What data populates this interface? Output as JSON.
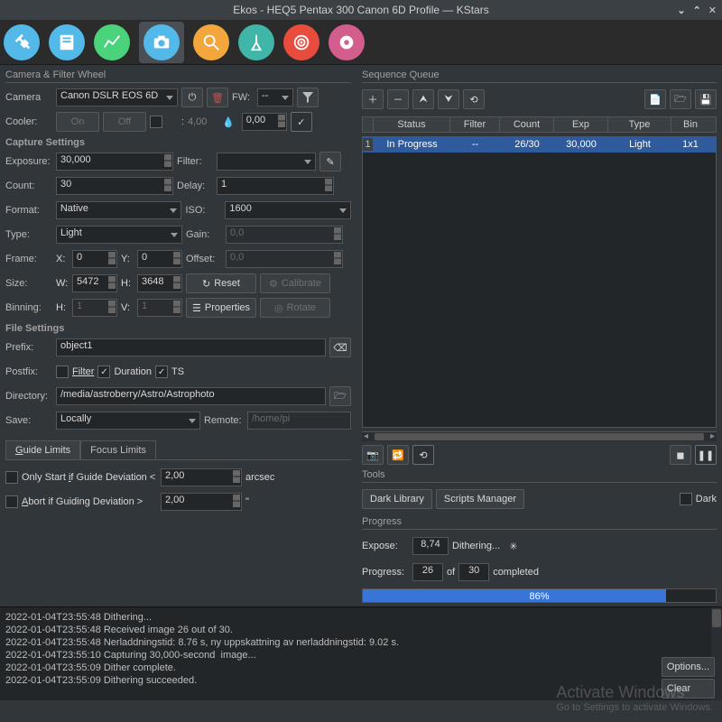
{
  "window": {
    "title": "Ekos - HEQ5 Pentax 300 Canon 6D Profile — KStars"
  },
  "left": {
    "section": "Camera & Filter Wheel",
    "camera_label": "Camera",
    "camera_value": "Canon DSLR EOS 6D",
    "fw_label": "FW:",
    "fw_value": "--",
    "cooler_label": "Cooler:",
    "cooler_on": "On",
    "cooler_off": "Off",
    "cooler_temp": "4,00",
    "humidity": "0,00",
    "capture_settings": "Capture Settings",
    "exposure_label": "Exposure:",
    "exposure_value": "30,000",
    "filter_label": "Filter:",
    "filter_value": "",
    "count_label": "Count:",
    "count_value": "30",
    "delay_label": "Delay:",
    "delay_value": "1",
    "format_label": "Format:",
    "format_value": "Native",
    "iso_label": "ISO:",
    "iso_value": "1600",
    "type_label": "Type:",
    "type_value": "Light",
    "gain_label": "Gain:",
    "gain_value": "0,0",
    "frame_label": "Frame:",
    "x_label": "X:",
    "x_value": "0",
    "y_label": "Y:",
    "y_value": "0",
    "offset_label": "Offset:",
    "offset_value": "0,0",
    "size_label": "Size:",
    "w_label": "W:",
    "w_value": "5472",
    "h_label": "H:",
    "h_value": "3648",
    "reset": "Reset",
    "calibrate": "Calibrate",
    "binning_label": "Binning:",
    "binh_label": "H:",
    "binh_value": "1",
    "binv_label": "V:",
    "binv_value": "1",
    "properties": "Properties",
    "rotate": "Rotate",
    "file_settings": "File Settings",
    "prefix_label": "Prefix:",
    "prefix_value": "object1",
    "postfix_label": "Postfix:",
    "post_filter": "Filter",
    "post_duration": "Duration",
    "post_ts": "TS",
    "directory_label": "Directory:",
    "directory_value": "/media/astroberry/Astro/Astrophoto",
    "save_label": "Save:",
    "save_value": "Locally",
    "remote_label": "Remote:",
    "remote_value": "/home/pi",
    "tab_guide": "Guide Limits",
    "tab_focus": "Focus Limits",
    "guide_start_label": "Only Start if Guide Deviation <",
    "guide_start_value": "2,00",
    "guide_start_unit": "arcsec",
    "guide_abort_label": "Abort if Guiding Deviation >",
    "guide_abort_value": "2,00",
    "guide_abort_unit": "\""
  },
  "right": {
    "section": "Sequence Queue",
    "headers": {
      "status": "Status",
      "filter": "Filter",
      "count": "Count",
      "exp": "Exp",
      "type": "Type",
      "bin": "Bin"
    },
    "row1": {
      "num": "1",
      "status": "In Progress",
      "filter": "--",
      "count": "26/30",
      "exp": "30,000",
      "type": "Light",
      "bin": "1x1"
    },
    "tools_label": "Tools",
    "dark_library": "Dark Library",
    "scripts_manager": "Scripts Manager",
    "dark_check": "Dark",
    "progress_label": "Progress",
    "expose_label": "Expose:",
    "expose_value": "8,74",
    "dithering": "Dithering...",
    "progress_prefix": "Progress:",
    "progress_done": "26",
    "progress_of": "of",
    "progress_total": "30",
    "progress_completed": "completed",
    "progress_pct": "86%",
    "progress_pct_num": 86
  },
  "log": {
    "l1": "2022-01-04T23:55:48 Dithering...",
    "l2": "2022-01-04T23:55:48 Received image 26 out of 30.",
    "l3": "2022-01-04T23:55:48 Nerladdningstid: 8.76 s, ny uppskattning av nerladdningstid: 9.02 s.",
    "l4": "2022-01-04T23:55:10 Capturing 30,000-second  image...",
    "l5": "2022-01-04T23:55:09 Dither complete.",
    "l6": "2022-01-04T23:55:09 Dithering succeeded.",
    "options": "Options...",
    "clear": "Clear"
  },
  "watermark": {
    "w1": "Activate Windows",
    "w2": "Go to Settings to activate Windows."
  }
}
